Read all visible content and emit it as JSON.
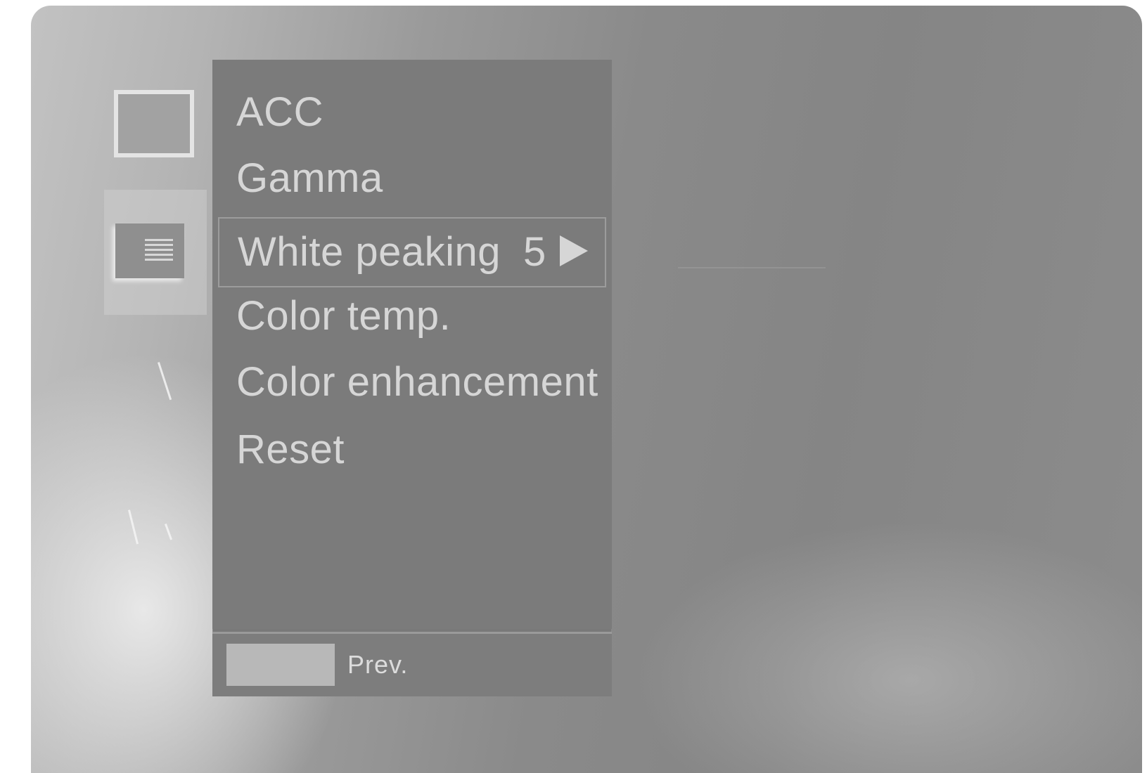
{
  "menu": {
    "items": [
      {
        "label": "ACC"
      },
      {
        "label": "Gamma"
      },
      {
        "label": "White peaking",
        "value": "5"
      },
      {
        "label": "Color temp."
      },
      {
        "label": "Color enhancement"
      },
      {
        "label": "Reset"
      }
    ],
    "selected_index": 2
  },
  "footer": {
    "prev_label": "Prev."
  },
  "icons": {
    "top": "screen-icon",
    "active": "picture-menu-icon",
    "arrow": "right-arrow-icon"
  },
  "colors": {
    "panel": "#797979",
    "text": "#d6d6d6",
    "prev_button": "#b8b8b8"
  }
}
